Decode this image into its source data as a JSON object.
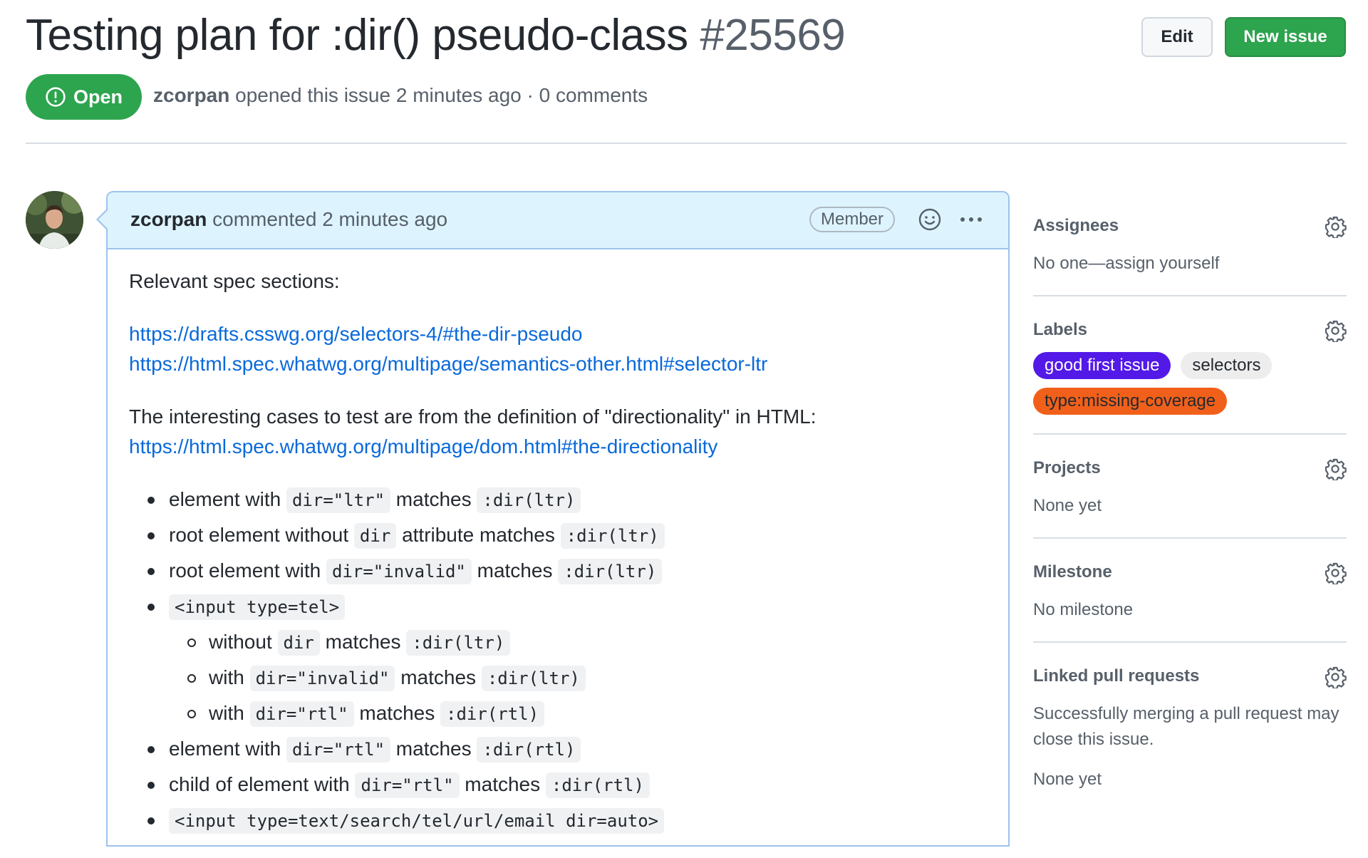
{
  "issue": {
    "title": "Testing plan for :dir() pseudo-class",
    "number": "#25569",
    "state": "Open",
    "author": "zcorpan",
    "opened_text": "opened this issue 2 minutes ago · 0 comments"
  },
  "header_buttons": {
    "edit": "Edit",
    "new_issue": "New issue"
  },
  "comment": {
    "author": "zcorpan",
    "action_text": "commented 2 minutes ago",
    "badge": "Member",
    "intro": "Relevant spec sections:",
    "links": [
      "https://drafts.csswg.org/selectors-4/#the-dir-pseudo",
      "https://html.spec.whatwg.org/multipage/semantics-other.html#selector-ltr"
    ],
    "cases_intro": "The interesting cases to test are from the definition of \"directionality\" in HTML:",
    "cases_link": "https://html.spec.whatwg.org/multipage/dom.html#the-directionality",
    "items": [
      {
        "t1": "element with",
        "c1": "dir=\"ltr\"",
        "t2": "matches",
        "c2": ":dir(ltr)"
      },
      {
        "t1": "root element without",
        "c1": "dir",
        "t2": "attribute matches",
        "c2": ":dir(ltr)"
      },
      {
        "t1": "root element with",
        "c1": "dir=\"invalid\"",
        "t2": "matches",
        "c2": ":dir(ltr)"
      },
      {
        "c1": "<input type=tel>",
        "sub": [
          {
            "t1": "without",
            "c1": "dir",
            "t2": "matches",
            "c2": ":dir(ltr)"
          },
          {
            "t1": "with",
            "c1": "dir=\"invalid\"",
            "t2": "matches",
            "c2": ":dir(ltr)"
          },
          {
            "t1": "with",
            "c1": "dir=\"rtl\"",
            "t2": "matches",
            "c2": ":dir(rtl)"
          }
        ]
      },
      {
        "t1": "element with",
        "c1": "dir=\"rtl\"",
        "t2": "matches",
        "c2": ":dir(rtl)"
      },
      {
        "t1": "child of element with",
        "c1": "dir=\"rtl\"",
        "t2": "matches",
        "c2": ":dir(rtl)"
      },
      {
        "c1": "<input type=text/search/tel/url/email dir=auto>"
      }
    ]
  },
  "sidebar": {
    "assignees": {
      "title": "Assignees",
      "value": "No one—assign yourself"
    },
    "labels": {
      "title": "Labels",
      "items": [
        {
          "name": "good first issue",
          "bg": "#5319e7",
          "fg": "#ffffff"
        },
        {
          "name": "selectors",
          "bg": "#ededed",
          "fg": "#24292f"
        },
        {
          "name": "type:missing-coverage",
          "bg": "#f1601a",
          "fg": "#24292f"
        }
      ]
    },
    "projects": {
      "title": "Projects",
      "value": "None yet"
    },
    "milestone": {
      "title": "Milestone",
      "value": "No milestone"
    },
    "linked_prs": {
      "title": "Linked pull requests",
      "value": "Successfully merging a pull request may close this issue.",
      "value2": "None yet"
    }
  },
  "colors": {
    "open_green": "#2da44e",
    "link_blue": "#0969da",
    "comment_header": "#ddf4ff"
  }
}
